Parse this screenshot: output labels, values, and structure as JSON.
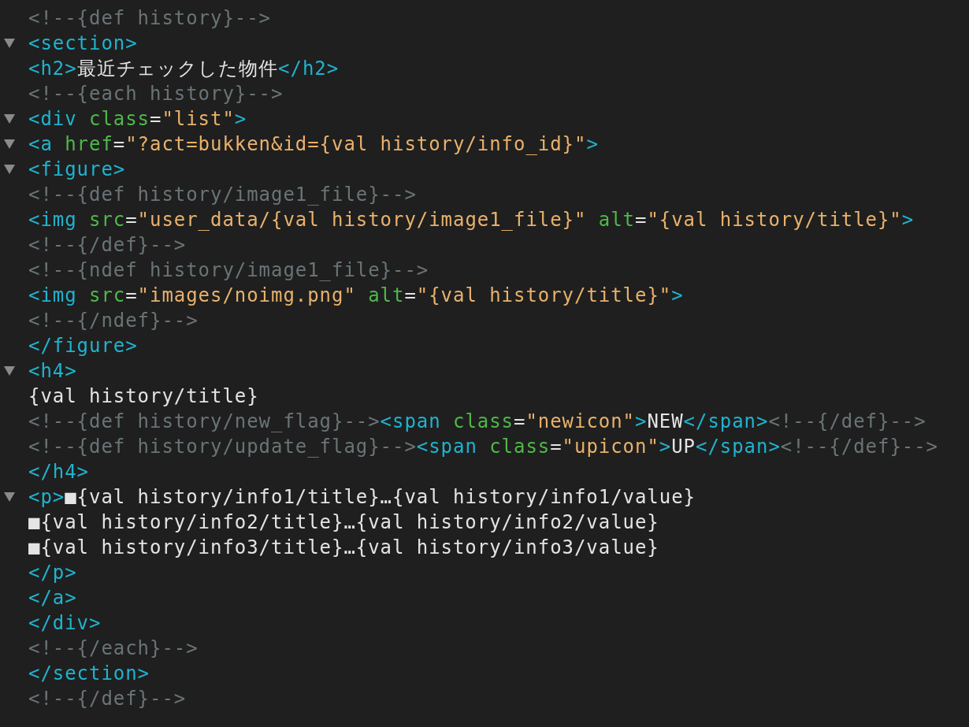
{
  "editor": {
    "lines": [
      {
        "fold": false,
        "tokens": [
          {
            "kind": "comment",
            "text": "<!--{def history}-->"
          }
        ]
      },
      {
        "fold": true,
        "tokens": [
          {
            "kind": "tag",
            "text": "<section>"
          }
        ]
      },
      {
        "fold": false,
        "tokens": [
          {
            "kind": "tag",
            "text": "<h2>"
          },
          {
            "kind": "text",
            "text": "最近チェックした物件"
          },
          {
            "kind": "tag",
            "text": "</h2>"
          }
        ]
      },
      {
        "fold": false,
        "tokens": [
          {
            "kind": "comment",
            "text": "<!--{each history}-->"
          }
        ]
      },
      {
        "fold": true,
        "tokens": [
          {
            "kind": "tag",
            "text": "<div "
          },
          {
            "kind": "attr",
            "text": "class"
          },
          {
            "kind": "text",
            "text": "="
          },
          {
            "kind": "string",
            "text": "\"list\""
          },
          {
            "kind": "tag",
            "text": ">"
          }
        ]
      },
      {
        "fold": true,
        "tokens": [
          {
            "kind": "tag",
            "text": "<a "
          },
          {
            "kind": "attr",
            "text": "href"
          },
          {
            "kind": "text",
            "text": "="
          },
          {
            "kind": "string",
            "text": "\"?act=bukken&id={val history/info_id}\""
          },
          {
            "kind": "tag",
            "text": ">"
          }
        ]
      },
      {
        "fold": true,
        "tokens": [
          {
            "kind": "tag",
            "text": "<figure>"
          }
        ]
      },
      {
        "fold": false,
        "tokens": [
          {
            "kind": "comment",
            "text": "<!--{def history/image1_file}-->"
          }
        ]
      },
      {
        "fold": false,
        "tokens": [
          {
            "kind": "tag",
            "text": "<img "
          },
          {
            "kind": "attr",
            "text": "src"
          },
          {
            "kind": "text",
            "text": "="
          },
          {
            "kind": "string",
            "text": "\"user_data/{val history/image1_file}\" "
          },
          {
            "kind": "attr",
            "text": "alt"
          },
          {
            "kind": "text",
            "text": "="
          },
          {
            "kind": "string",
            "text": "\"{val history/title}\""
          },
          {
            "kind": "tag",
            "text": ">"
          }
        ]
      },
      {
        "fold": false,
        "tokens": [
          {
            "kind": "comment",
            "text": "<!--{/def}-->"
          }
        ]
      },
      {
        "fold": false,
        "tokens": [
          {
            "kind": "comment",
            "text": "<!--{ndef history/image1_file}-->"
          }
        ]
      },
      {
        "fold": false,
        "tokens": [
          {
            "kind": "tag",
            "text": "<img "
          },
          {
            "kind": "attr",
            "text": "src"
          },
          {
            "kind": "text",
            "text": "="
          },
          {
            "kind": "string",
            "text": "\"images/noimg.png\" "
          },
          {
            "kind": "attr",
            "text": "alt"
          },
          {
            "kind": "text",
            "text": "="
          },
          {
            "kind": "string",
            "text": "\"{val history/title}\""
          },
          {
            "kind": "tag",
            "text": ">"
          }
        ]
      },
      {
        "fold": false,
        "tokens": [
          {
            "kind": "comment",
            "text": "<!--{/ndef}-->"
          }
        ]
      },
      {
        "fold": false,
        "tokens": [
          {
            "kind": "tag",
            "text": "</figure>"
          }
        ]
      },
      {
        "fold": true,
        "tokens": [
          {
            "kind": "tag",
            "text": "<h4>"
          }
        ]
      },
      {
        "fold": false,
        "tokens": [
          {
            "kind": "text",
            "text": "{val history/title}"
          }
        ]
      },
      {
        "fold": false,
        "tokens": [
          {
            "kind": "comment",
            "text": "<!--{def history/new_flag}-->"
          },
          {
            "kind": "tag",
            "text": "<span "
          },
          {
            "kind": "attr",
            "text": "class"
          },
          {
            "kind": "text",
            "text": "="
          },
          {
            "kind": "string",
            "text": "\"newicon\""
          },
          {
            "kind": "tag",
            "text": ">"
          },
          {
            "kind": "text",
            "text": "NEW"
          },
          {
            "kind": "tag",
            "text": "</span>"
          },
          {
            "kind": "comment",
            "text": "<!--{/def}-->"
          }
        ]
      },
      {
        "fold": false,
        "tokens": [
          {
            "kind": "comment",
            "text": "<!--{def history/update_flag}-->"
          },
          {
            "kind": "tag",
            "text": "<span "
          },
          {
            "kind": "attr",
            "text": "class"
          },
          {
            "kind": "text",
            "text": "="
          },
          {
            "kind": "string",
            "text": "\"upicon\""
          },
          {
            "kind": "tag",
            "text": ">"
          },
          {
            "kind": "text",
            "text": "UP"
          },
          {
            "kind": "tag",
            "text": "</span>"
          },
          {
            "kind": "comment",
            "text": "<!--{/def}-->"
          }
        ]
      },
      {
        "fold": false,
        "tokens": [
          {
            "kind": "tag",
            "text": "</h4>"
          }
        ]
      },
      {
        "fold": true,
        "tokens": [
          {
            "kind": "tag",
            "text": "<p>"
          },
          {
            "kind": "text",
            "text": "■{val history/info1/title}…{val history/info1/value}"
          }
        ]
      },
      {
        "fold": false,
        "tokens": [
          {
            "kind": "text",
            "text": "■{val history/info2/title}…{val history/info2/value}"
          }
        ]
      },
      {
        "fold": false,
        "tokens": [
          {
            "kind": "text",
            "text": "■{val history/info3/title}…{val history/info3/value}"
          }
        ]
      },
      {
        "fold": false,
        "tokens": [
          {
            "kind": "tag",
            "text": "</p>"
          }
        ]
      },
      {
        "fold": false,
        "tokens": [
          {
            "kind": "tag",
            "text": "</a>"
          }
        ]
      },
      {
        "fold": false,
        "tokens": [
          {
            "kind": "tag",
            "text": "</div>"
          }
        ]
      },
      {
        "fold": false,
        "tokens": [
          {
            "kind": "comment",
            "text": "<!--{/each}-->"
          }
        ]
      },
      {
        "fold": false,
        "tokens": [
          {
            "kind": "tag",
            "text": "</section>"
          }
        ]
      },
      {
        "fold": false,
        "tokens": [
          {
            "kind": "comment",
            "text": "<!--{/def}-->"
          }
        ]
      }
    ]
  }
}
